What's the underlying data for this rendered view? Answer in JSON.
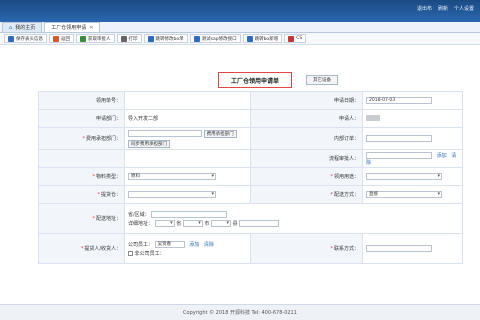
{
  "topbar": {
    "links": [
      "退出布",
      "刷新",
      "个人设置"
    ]
  },
  "tabs": [
    {
      "label": "我的主页",
      "active": false
    },
    {
      "label": "工厂仓领用申请",
      "active": true
    }
  ],
  "toolbar": {
    "buttons": [
      "保存表头信息",
      "返回",
      "获取审批人",
      "打印",
      "跳转修改bo单",
      "测试sap修改接口",
      "跳转bo新增",
      "CS"
    ]
  },
  "form": {
    "title": "工厂仓领用申请单",
    "print_label": "其它设备",
    "apply_no_label": "领用单号：",
    "apply_no": "",
    "apply_date_label": "申请日期：",
    "apply_date": "2018-07-03",
    "dept_label": "申请部门：",
    "dept": "导入开发二部",
    "applicant_label": "申请人：",
    "cost_dept_label": "费用承担部门：",
    "cost_dept_btn": "费用承担部门",
    "cost_dept_btn2": "同步费用承担部门",
    "internal_order_label": "内部订单：",
    "approver_label": "流程审批人：",
    "add_link": "添加",
    "clear_link": "清除",
    "material_type_label": "物料类型：",
    "material_type": "原料",
    "purpose_label": "领用用途：",
    "supply_label": "提货仓：",
    "delivery_label": "配送方式：",
    "delivery": "直接",
    "address_label": "配送地址：",
    "addr_region_label": "省/区域：",
    "addr_detail_label": "详细地址：",
    "province_label": "省",
    "city_label": "市",
    "district_label": "县",
    "person_label": "提货人/收货人：",
    "company_employee_label": "公司员工：",
    "company_employee_value": "吴贤春",
    "non_company_label": "非公司员工：",
    "contact_label": "联系方式："
  },
  "footer": {
    "text": "Copyright © 2018 开源科技 Tel: 400-678-0211"
  },
  "colors": {
    "accent": "#2b68b0",
    "required": "#e33333",
    "title_border": "#e04848"
  }
}
